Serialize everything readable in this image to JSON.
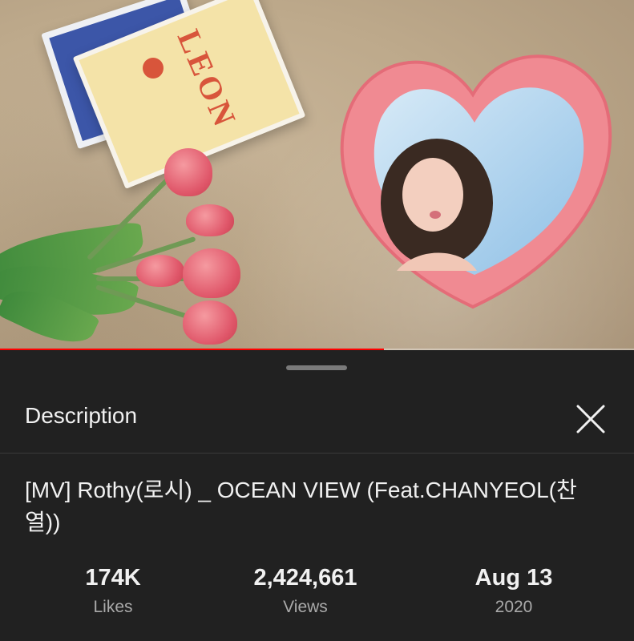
{
  "video": {
    "thumbnail_description_icon": "video-frame",
    "book_title": "LEON",
    "progress_fraction": 0.605,
    "progress_color": "#ff0000"
  },
  "sheet": {
    "title": "Description",
    "close_icon": "close-icon"
  },
  "video_info": {
    "title": "[MV] Rothy(로시) _ OCEAN VIEW (Feat.CHANYEOL(찬열))"
  },
  "stats": [
    {
      "value": "174K",
      "label": "Likes"
    },
    {
      "value": "2,424,661",
      "label": "Views"
    },
    {
      "value": "Aug 13",
      "label": "2020"
    }
  ]
}
